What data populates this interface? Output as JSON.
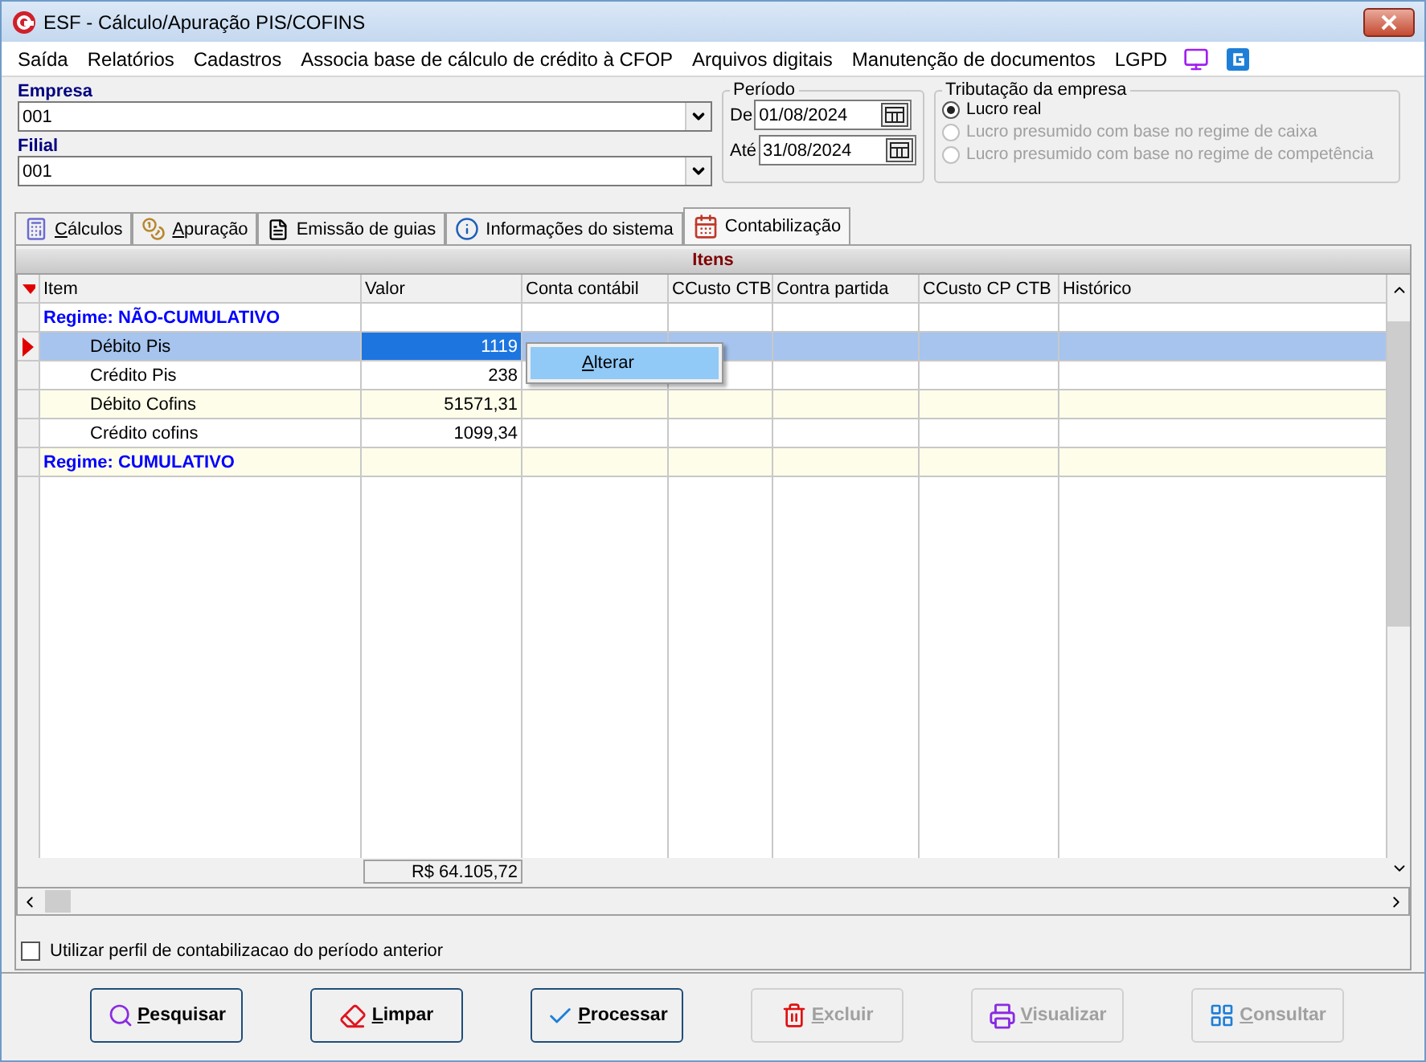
{
  "window": {
    "title": "ESF - Cálculo/Apuração PIS/COFINS"
  },
  "menu": [
    {
      "label": "Saída"
    },
    {
      "label": "Relatórios"
    },
    {
      "label": "Cadastros"
    },
    {
      "label": "Associa base de cálculo de crédito à CFOP"
    },
    {
      "label": "Arquivos digitais"
    },
    {
      "label": "Manutenção de documentos"
    },
    {
      "label": "LGPD"
    }
  ],
  "empresa": {
    "label": "Empresa",
    "value": "001"
  },
  "filial": {
    "label": "Filial",
    "value": "001"
  },
  "periodo": {
    "title": "Período",
    "from_label": "De",
    "from": "01/08/2024",
    "to_label": "Até",
    "to": "31/08/2024"
  },
  "tributacao": {
    "title": "Tributação da empresa",
    "options": [
      {
        "label": "Lucro real",
        "selected": true,
        "disabled": false
      },
      {
        "label": "Lucro presumido com base no regime de caixa",
        "selected": false,
        "disabled": true
      },
      {
        "label": "Lucro presumido com base no regime de competência",
        "selected": false,
        "disabled": true
      }
    ]
  },
  "tabs": [
    {
      "label": "Cálculos",
      "kind": "calc",
      "mnemonic": true,
      "selected": false
    },
    {
      "label": "Apuração",
      "kind": "coins",
      "mnemonic": true,
      "selected": false
    },
    {
      "label": "Emissão de guias",
      "kind": "doc",
      "mnemonic": false,
      "selected": false
    },
    {
      "label": "Informações do sistema",
      "kind": "info",
      "mnemonic": false,
      "selected": false
    },
    {
      "label": "Contabilização",
      "kind": "calendar",
      "mnemonic": false,
      "selected": true
    }
  ],
  "grid": {
    "title": "Itens",
    "columns": [
      "Item",
      "Valor",
      "Conta contábil",
      "CCusto CTB",
      "Contra partida",
      "CCusto CP CTB",
      "Histórico"
    ],
    "rows": [
      {
        "kind": "group",
        "item": "Regime: NÃO-CUMULATIVO",
        "selected": false
      },
      {
        "kind": "item",
        "item": "Débito Pis",
        "valor": "1119",
        "selected": true
      },
      {
        "kind": "item",
        "item": "Crédito Pis",
        "valor": "238",
        "selected": false
      },
      {
        "kind": "item",
        "item": "Débito Cofins",
        "valor": "51571,31",
        "selected": false
      },
      {
        "kind": "item",
        "item": "Crédito cofins",
        "valor": "1099,34",
        "selected": false
      },
      {
        "kind": "group",
        "item": "Regime: CUMULATIVO",
        "selected": false
      }
    ],
    "total": "R$ 64.105,72"
  },
  "context_menu": {
    "items": [
      {
        "label": "Alterar",
        "selected": true
      }
    ]
  },
  "option": {
    "label": "Utilizar perfil de contabilizacao do período anterior",
    "checked": false
  },
  "buttons": [
    {
      "label": "Pesquisar",
      "kind": "search",
      "disabled": false
    },
    {
      "label": "Limpar",
      "kind": "eraser",
      "disabled": false
    },
    {
      "label": "Processar",
      "kind": "check",
      "disabled": false
    },
    {
      "label": "Excluir",
      "kind": "trash",
      "disabled": true
    },
    {
      "label": "Visualizar",
      "kind": "print",
      "disabled": true
    },
    {
      "label": "Consultar",
      "kind": "grid",
      "disabled": true
    }
  ]
}
